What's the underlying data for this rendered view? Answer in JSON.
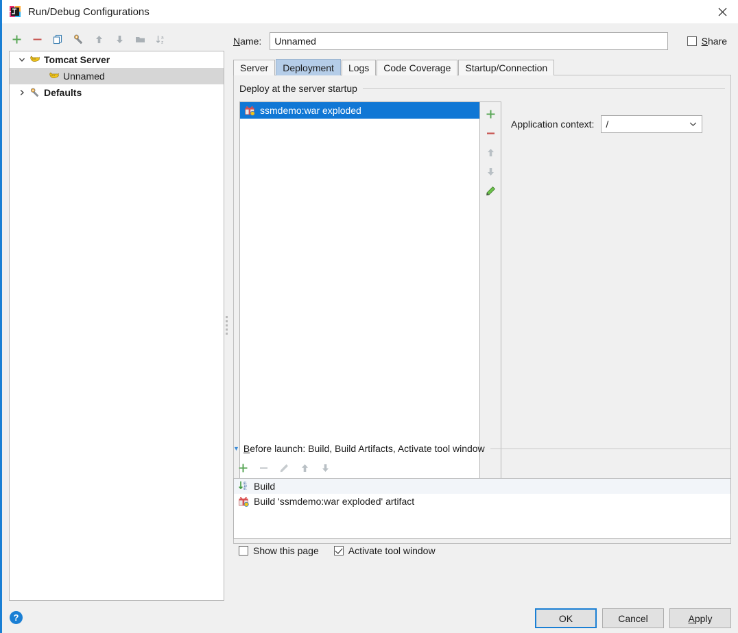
{
  "window": {
    "title": "Run/Debug Configurations",
    "app_icon": "intellij-idea-logo",
    "close_icon": "close-icon",
    "accent_color": "#1a7fd4"
  },
  "toolbar": {
    "buttons": [
      {
        "name": "add-configuration-button",
        "icon": "plus-icon",
        "label": "+"
      },
      {
        "name": "remove-configuration-button",
        "icon": "minus-icon",
        "label": "−"
      },
      {
        "name": "copy-configuration-button",
        "icon": "copy-icon",
        "label": "Copy"
      },
      {
        "name": "edit-defaults-button",
        "icon": "wrench-icon",
        "label": "Edit defaults"
      },
      {
        "name": "move-up-button",
        "icon": "arrow-up-icon",
        "label": "Move up"
      },
      {
        "name": "move-down-button",
        "icon": "arrow-down-icon",
        "label": "Move down"
      },
      {
        "name": "new-folder-button",
        "icon": "folder-icon",
        "label": "New folder"
      },
      {
        "name": "sort-button",
        "icon": "sort-alpha-icon",
        "label": "Sort"
      }
    ]
  },
  "tree": {
    "items": [
      {
        "label": "Tomcat Server",
        "icon": "tomcat-icon",
        "twisty": "expanded",
        "level": 0,
        "selected": false
      },
      {
        "label": "Unnamed",
        "icon": "tomcat-icon",
        "twisty": "none",
        "level": 1,
        "selected": true
      },
      {
        "label": "Defaults",
        "icon": "wrench-icon",
        "twisty": "collapsed",
        "level": 0,
        "selected": false
      }
    ]
  },
  "name_row": {
    "label_prefix": "N",
    "label_rest": "ame:",
    "value": "Unnamed",
    "placeholder": "",
    "share_label_prefix": "S",
    "share_label_rest": "hare",
    "share_checked": false
  },
  "tabs": [
    {
      "label": "Server",
      "active": false
    },
    {
      "label": "Deployment",
      "active": true
    },
    {
      "label": "Logs",
      "active": false
    },
    {
      "label": "Code Coverage",
      "active": false
    },
    {
      "label": "Startup/Connection",
      "active": false
    }
  ],
  "deployment": {
    "group_title": "Deploy at the server startup",
    "artifacts": [
      {
        "label": "ssmdemo:war exploded",
        "icon": "artifact-icon",
        "selected": true
      }
    ],
    "side_buttons": [
      {
        "name": "add-artifact-button",
        "icon": "plus-icon"
      },
      {
        "name": "remove-artifact-button",
        "icon": "minus-icon"
      },
      {
        "name": "move-artifact-up-button",
        "icon": "arrow-up-icon"
      },
      {
        "name": "move-artifact-down-button",
        "icon": "arrow-down-icon"
      },
      {
        "name": "edit-artifact-button",
        "icon": "pencil-icon"
      }
    ],
    "app_context_label": "Application context:",
    "app_context_value": "/"
  },
  "before_launch": {
    "header_prefix": "B",
    "header_rest": "efore launch: Build, Build Artifacts, Activate tool window",
    "toolbar": [
      {
        "name": "add-task-button",
        "icon": "plus-icon",
        "enabled": true
      },
      {
        "name": "remove-task-button",
        "icon": "minus-icon",
        "enabled": false
      },
      {
        "name": "edit-task-button",
        "icon": "pencil-icon",
        "enabled": false
      },
      {
        "name": "move-task-up-button",
        "icon": "arrow-up-icon",
        "enabled": false
      },
      {
        "name": "move-task-down-button",
        "icon": "arrow-down-icon",
        "enabled": false
      }
    ],
    "tasks": [
      {
        "label": "Build",
        "icon": "build-icon"
      },
      {
        "label": "Build 'ssmdemo:war exploded' artifact",
        "icon": "artifact-icon"
      }
    ],
    "show_page_label": "Show this page",
    "show_page_checked": false,
    "activate_tool_window_label": "Activate tool window",
    "activate_tool_window_checked": true
  },
  "footer": {
    "help_label": "?",
    "ok_label": "OK",
    "cancel_label": "Cancel",
    "apply_prefix": "A",
    "apply_rest": "pply"
  }
}
